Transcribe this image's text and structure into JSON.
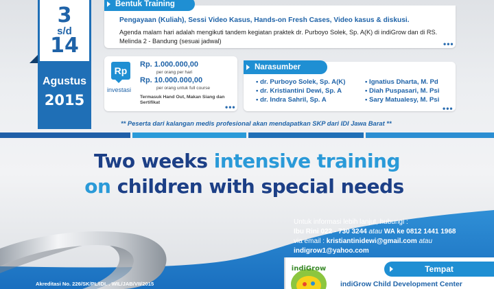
{
  "date": {
    "start_day": "3",
    "separator": "s/d",
    "end_day": "14",
    "month": "Agustus",
    "year": "2015"
  },
  "training": {
    "tab_label": "Bentuk Training",
    "line1": "Pengayaan (Kuliah), Sessi Video Kasus, Hands-on Fresh Cases, Video kasus & diskusi.",
    "line2": "Agenda malam hari adalah mengikuti tandem kegiatan praktek dr. Purboyo Solek, Sp. A(K) di indiGrow dan di RS. Melinda 2 - Bandung (sesuai jadwal)"
  },
  "investment": {
    "icon_text": "Rp",
    "label": "investasi",
    "price1": "Rp. 1.000.000,00",
    "price1_sub": "per orang per hari",
    "price2": "Rp. 10.000.000,00",
    "price2_sub": "per orang untuk full course",
    "note": "Termasuk Hand Out, Makan Siang dan Sertifikat"
  },
  "speakers": {
    "tab_label": "Narasumber",
    "left": [
      "dr. Purboyo Solek, Sp. A(K)",
      "dr. Kristiantini Dewi, Sp. A",
      "dr. Indra Sahril, Sp. A"
    ],
    "right": [
      "Ignatius Dharta, M. Pd",
      "Diah Puspasari, M. Psi",
      "Sary Matualesy, M. Psi"
    ]
  },
  "note_skp": "** Peserta dari kalangan medis profesional akan mendapatkan SKP dari IDI Jawa Barat **",
  "headline": {
    "line1_part1": "Two weeks",
    "line1_part2": "intensive training",
    "line2_part1": "on",
    "line2_part2": "children with special needs"
  },
  "contact": {
    "intro": "Untuk informasi lebih lanjut, hubungi :",
    "phone_prefix": "Ibu Rini 022 - 730 3244",
    "phone_atau": "atau",
    "phone_suffix": "WA ke 0812 1441 1968",
    "email_prefix": "via email :",
    "email1": "kristiantinidewi@gmail.com",
    "email_atau": "atau",
    "email2": "indigrow1@yahoo.com"
  },
  "venue": {
    "tab_label": "Tempat",
    "name": "indiGrow Child Development Center",
    "logo_text": "indiGrow"
  },
  "akreditasi": "Akreditasi No. 226/SK/PL/IDI. . WIL/JAB/VII/2015",
  "colors": {
    "primary_blue": "#1f6fb6",
    "accent_blue": "#1f8fd3",
    "navy": "#1c3f86",
    "light_blue": "#2a9ad8"
  }
}
